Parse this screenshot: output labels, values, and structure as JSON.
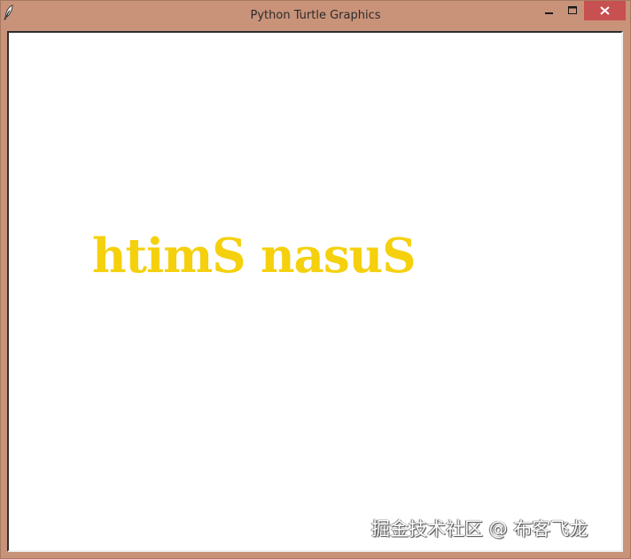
{
  "window": {
    "title": "Python Turtle Graphics",
    "icon": "feather-icon",
    "controls": {
      "minimize": "minimize-icon",
      "maximize": "maximize-icon",
      "close": "close-icon"
    },
    "frame_color": "#c9937a",
    "close_color": "#c75050"
  },
  "canvas": {
    "text": "htimS nasuS",
    "text_color": "#f5d00d",
    "background": "#ffffff"
  },
  "watermark": {
    "text": "掘金技术社区 @ 布客飞龙"
  }
}
